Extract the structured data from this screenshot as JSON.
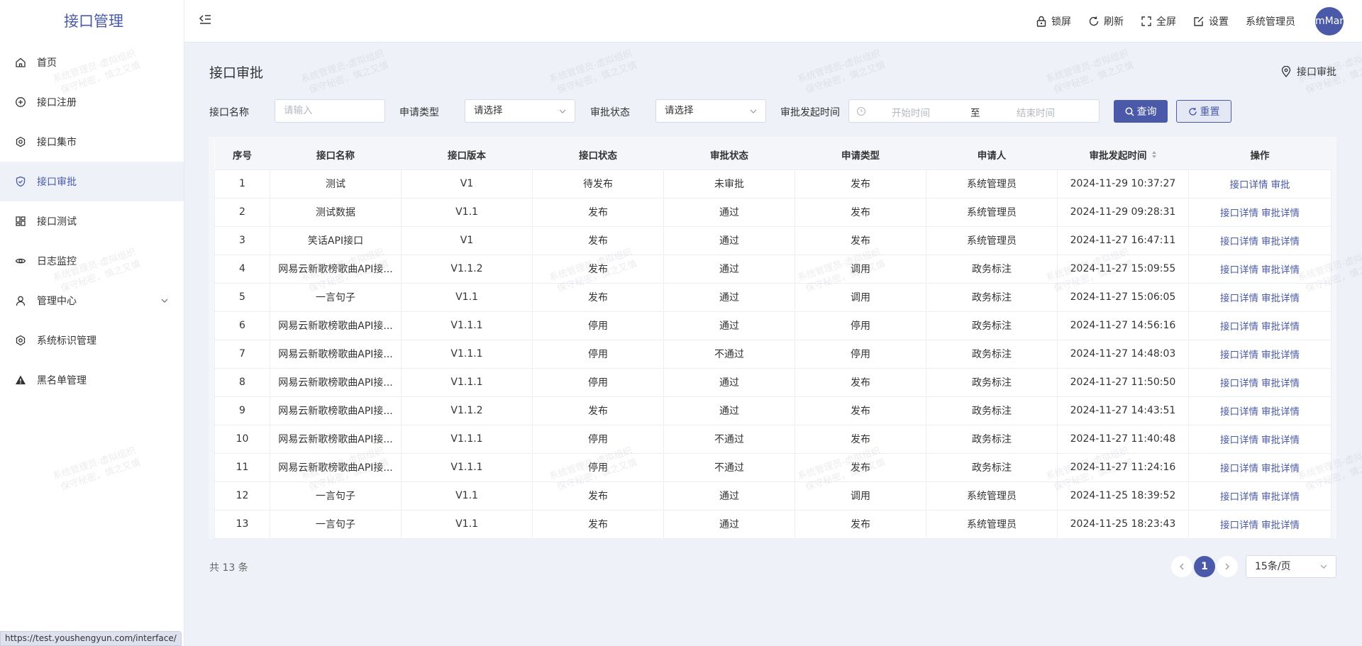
{
  "app": {
    "title": "接口管理"
  },
  "sidebar": {
    "items": [
      {
        "label": "首页",
        "icon": "home-icon"
      },
      {
        "label": "接口注册",
        "icon": "plus-circle-icon"
      },
      {
        "label": "接口集市",
        "icon": "gear-icon"
      },
      {
        "label": "接口审批",
        "icon": "shield-check-icon",
        "active": true
      },
      {
        "label": "接口测试",
        "icon": "dashboard-icon"
      },
      {
        "label": "日志监控",
        "icon": "eye-icon"
      },
      {
        "label": "管理中心",
        "icon": "user-icon",
        "expandable": true
      },
      {
        "label": "系统标识管理",
        "icon": "gear-icon"
      },
      {
        "label": "黑名单管理",
        "icon": "warning-icon"
      }
    ]
  },
  "header": {
    "lock": "锁屏",
    "refresh": "刷新",
    "fullscreen": "全屏",
    "settings": "设置",
    "user": "系统管理员",
    "avatar_text": "mMan"
  },
  "page": {
    "title": "接口审批",
    "breadcrumb": "接口审批"
  },
  "filters": {
    "name_label": "接口名称",
    "name_placeholder": "请输入",
    "type_label": "申请类型",
    "type_value": "请选择",
    "status_label": "审批状态",
    "status_value": "请选择",
    "time_label": "审批发起时间",
    "start_placeholder": "开始时间",
    "separator": "至",
    "end_placeholder": "结束时间",
    "query": "查询",
    "reset": "重置"
  },
  "table": {
    "columns": [
      "序号",
      "接口名称",
      "接口版本",
      "接口状态",
      "审批状态",
      "申请类型",
      "申请人",
      "审批发起时间",
      "操作"
    ],
    "rows": [
      {
        "no": "1",
        "name": "测试",
        "version": "V1",
        "status": "待发布",
        "approval": "未审批",
        "type": "发布",
        "applicant": "系统管理员",
        "time": "2024-11-29 10:37:27",
        "ops": [
          "接口详情",
          "审批"
        ]
      },
      {
        "no": "2",
        "name": "测试数据",
        "version": "V1.1",
        "status": "发布",
        "approval": "通过",
        "type": "发布",
        "applicant": "系统管理员",
        "time": "2024-11-29 09:28:31",
        "ops": [
          "接口详情",
          "审批详情"
        ]
      },
      {
        "no": "3",
        "name": "笑话API接口",
        "version": "V1",
        "status": "发布",
        "approval": "通过",
        "type": "发布",
        "applicant": "系统管理员",
        "time": "2024-11-27 16:47:11",
        "ops": [
          "接口详情",
          "审批详情"
        ]
      },
      {
        "no": "4",
        "name": "网易云新歌榜歌曲API接...",
        "version": "V1.1.2",
        "status": "发布",
        "approval": "通过",
        "type": "调用",
        "applicant": "政务标注",
        "time": "2024-11-27 15:09:55",
        "ops": [
          "接口详情",
          "审批详情"
        ]
      },
      {
        "no": "5",
        "name": "一言句子",
        "version": "V1.1",
        "status": "发布",
        "approval": "通过",
        "type": "调用",
        "applicant": "政务标注",
        "time": "2024-11-27 15:06:05",
        "ops": [
          "接口详情",
          "审批详情"
        ]
      },
      {
        "no": "6",
        "name": "网易云新歌榜歌曲API接...",
        "version": "V1.1.1",
        "status": "停用",
        "approval": "通过",
        "type": "停用",
        "applicant": "政务标注",
        "time": "2024-11-27 14:56:16",
        "ops": [
          "接口详情",
          "审批详情"
        ]
      },
      {
        "no": "7",
        "name": "网易云新歌榜歌曲API接...",
        "version": "V1.1.1",
        "status": "停用",
        "approval": "不通过",
        "type": "停用",
        "applicant": "政务标注",
        "time": "2024-11-27 14:48:03",
        "ops": [
          "接口详情",
          "审批详情"
        ]
      },
      {
        "no": "8",
        "name": "网易云新歌榜歌曲API接...",
        "version": "V1.1.1",
        "status": "停用",
        "approval": "通过",
        "type": "发布",
        "applicant": "政务标注",
        "time": "2024-11-27 11:50:50",
        "ops": [
          "接口详情",
          "审批详情"
        ]
      },
      {
        "no": "9",
        "name": "网易云新歌榜歌曲API接...",
        "version": "V1.1.2",
        "status": "发布",
        "approval": "通过",
        "type": "发布",
        "applicant": "政务标注",
        "time": "2024-11-27 14:43:51",
        "ops": [
          "接口详情",
          "审批详情"
        ]
      },
      {
        "no": "10",
        "name": "网易云新歌榜歌曲API接...",
        "version": "V1.1.1",
        "status": "停用",
        "approval": "不通过",
        "type": "发布",
        "applicant": "政务标注",
        "time": "2024-11-27 11:40:48",
        "ops": [
          "接口详情",
          "审批详情"
        ]
      },
      {
        "no": "11",
        "name": "网易云新歌榜歌曲API接...",
        "version": "V1.1.1",
        "status": "停用",
        "approval": "不通过",
        "type": "发布",
        "applicant": "政务标注",
        "time": "2024-11-27 11:24:16",
        "ops": [
          "接口详情",
          "审批详情"
        ]
      },
      {
        "no": "12",
        "name": "一言句子",
        "version": "V1.1",
        "status": "发布",
        "approval": "通过",
        "type": "调用",
        "applicant": "系统管理员",
        "time": "2024-11-25 18:39:52",
        "ops": [
          "接口详情",
          "审批详情"
        ]
      },
      {
        "no": "13",
        "name": "一言句子",
        "version": "V1.1",
        "status": "发布",
        "approval": "通过",
        "type": "发布",
        "applicant": "系统管理员",
        "time": "2024-11-25 18:23:43",
        "ops": [
          "接口详情",
          "审批详情"
        ]
      }
    ]
  },
  "pagination": {
    "total": "共 13 条",
    "current": "1",
    "page_size": "15条/页"
  },
  "status_url": "https://test.youshengyun.com/interface/",
  "watermark": {
    "line1": "系统管理员-虚拟组织",
    "line2": "保守秘密，慎之又慎"
  },
  "colors": {
    "accent": "#4a5aa8",
    "background": "#eef1f7"
  }
}
